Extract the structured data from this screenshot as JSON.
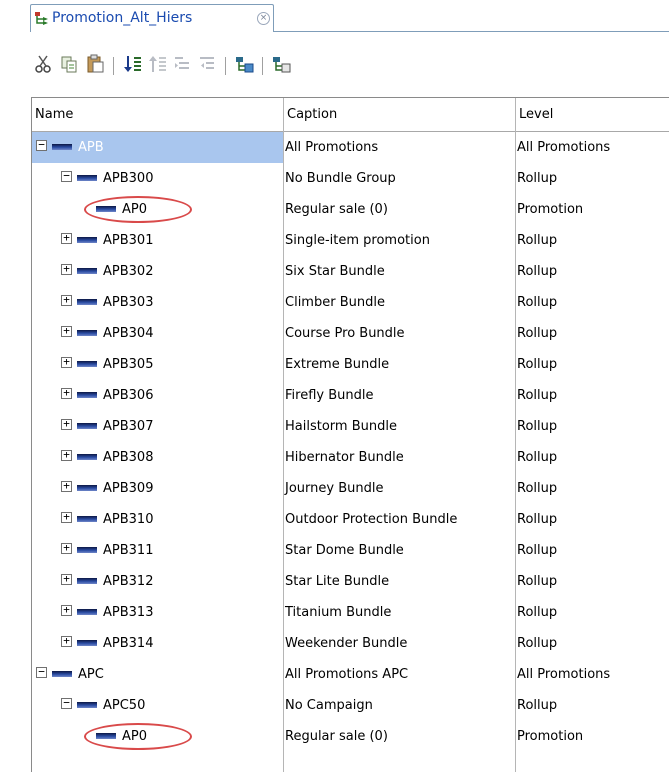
{
  "tab": {
    "title": "Promotion_Alt_Hiers",
    "close_glyph": "×"
  },
  "toolbar": {
    "icons": [
      "cut-icon",
      "copy-icon",
      "paste-icon",
      "sort-icon",
      "move-up-icon",
      "indent-icon",
      "outdent-icon",
      "filter-icon",
      "hierarchy-icon"
    ]
  },
  "columns": {
    "name": "Name",
    "caption": "Caption",
    "level": "Level"
  },
  "rows": [
    {
      "name": "APB",
      "caption": "All Promotions",
      "level": "All Promotions",
      "depth": 0,
      "expander": "−",
      "selected": true
    },
    {
      "name": "APB300",
      "caption": "No Bundle Group",
      "level": "Rollup",
      "depth": 1,
      "expander": "−"
    },
    {
      "name": "AP0",
      "caption": "Regular sale (0)",
      "level": "Promotion",
      "depth": 2,
      "expander": "",
      "highlighted": true
    },
    {
      "name": "APB301",
      "caption": "Single-item promotion",
      "level": "Rollup",
      "depth": 1,
      "expander": "+"
    },
    {
      "name": "APB302",
      "caption": "Six Star Bundle",
      "level": "Rollup",
      "depth": 1,
      "expander": "+"
    },
    {
      "name": "APB303",
      "caption": "Climber Bundle",
      "level": "Rollup",
      "depth": 1,
      "expander": "+"
    },
    {
      "name": "APB304",
      "caption": "Course Pro Bundle",
      "level": "Rollup",
      "depth": 1,
      "expander": "+"
    },
    {
      "name": "APB305",
      "caption": "Extreme Bundle",
      "level": "Rollup",
      "depth": 1,
      "expander": "+"
    },
    {
      "name": "APB306",
      "caption": "Firefly Bundle",
      "level": "Rollup",
      "depth": 1,
      "expander": "+"
    },
    {
      "name": "APB307",
      "caption": "Hailstorm Bundle",
      "level": "Rollup",
      "depth": 1,
      "expander": "+"
    },
    {
      "name": "APB308",
      "caption": "Hibernator Bundle",
      "level": "Rollup",
      "depth": 1,
      "expander": "+"
    },
    {
      "name": "APB309",
      "caption": "Journey Bundle",
      "level": "Rollup",
      "depth": 1,
      "expander": "+"
    },
    {
      "name": "APB310",
      "caption": "Outdoor Protection Bundle",
      "level": "Rollup",
      "depth": 1,
      "expander": "+"
    },
    {
      "name": "APB311",
      "caption": "Star Dome Bundle",
      "level": "Rollup",
      "depth": 1,
      "expander": "+"
    },
    {
      "name": "APB312",
      "caption": "Star Lite Bundle",
      "level": "Rollup",
      "depth": 1,
      "expander": "+"
    },
    {
      "name": "APB313",
      "caption": "Titanium Bundle",
      "level": "Rollup",
      "depth": 1,
      "expander": "+"
    },
    {
      "name": "APB314",
      "caption": "Weekender Bundle",
      "level": "Rollup",
      "depth": 1,
      "expander": "+"
    },
    {
      "name": "APC",
      "caption": "All Promotions APC",
      "level": "All Promotions",
      "depth": 0,
      "expander": "−"
    },
    {
      "name": "APC50",
      "caption": "No Campaign",
      "level": "Rollup",
      "depth": 1,
      "expander": "−"
    },
    {
      "name": "AP0",
      "caption": "Regular sale (0)",
      "level": "Promotion",
      "depth": 2,
      "expander": "",
      "highlighted": true
    }
  ],
  "colors": {
    "selection": "#a9c6ee",
    "highlight_ring": "#d94a4a",
    "tab_title": "#1a4bb0"
  }
}
